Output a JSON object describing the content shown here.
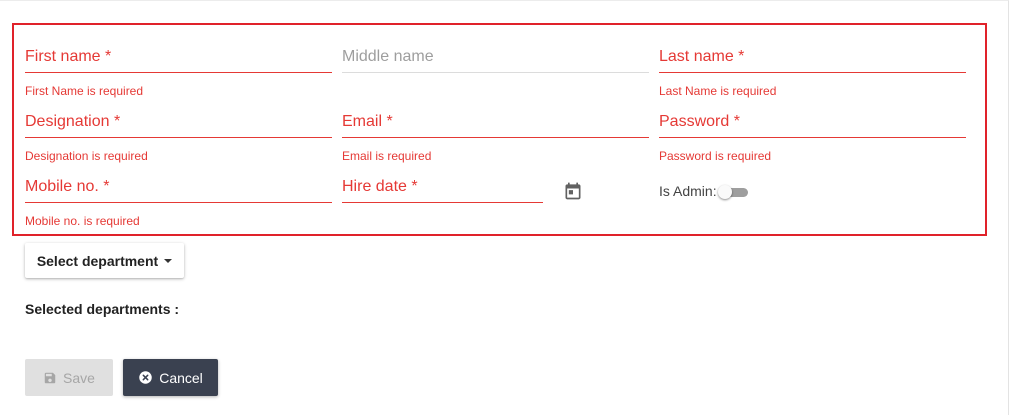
{
  "form": {
    "first_name": {
      "label": "First name *",
      "error": "First Name is required"
    },
    "middle_name": {
      "label": "Middle name"
    },
    "last_name": {
      "label": "Last name *",
      "error": "Last Name is required"
    },
    "designation": {
      "label": "Designation *",
      "error": "Designation is required"
    },
    "email": {
      "label": "Email *",
      "error": "Email is required"
    },
    "password": {
      "label": "Password *",
      "error": "Password is required"
    },
    "mobile": {
      "label": "Mobile no. *",
      "error": "Mobile no. is required"
    },
    "hire_date": {
      "label": "Hire date *",
      "icon": "calendar-icon"
    },
    "is_admin": {
      "label": "Is Admin:",
      "checked": false
    }
  },
  "department": {
    "button_label": "Select department",
    "selected_label": "Selected departments :"
  },
  "actions": {
    "save_label": "Save",
    "cancel_label": "Cancel"
  },
  "colors": {
    "error": "#e53935",
    "highlight_border": "#e0222a",
    "cancel_bg": "#3a4150",
    "save_disabled_bg": "#e0e0e0"
  }
}
